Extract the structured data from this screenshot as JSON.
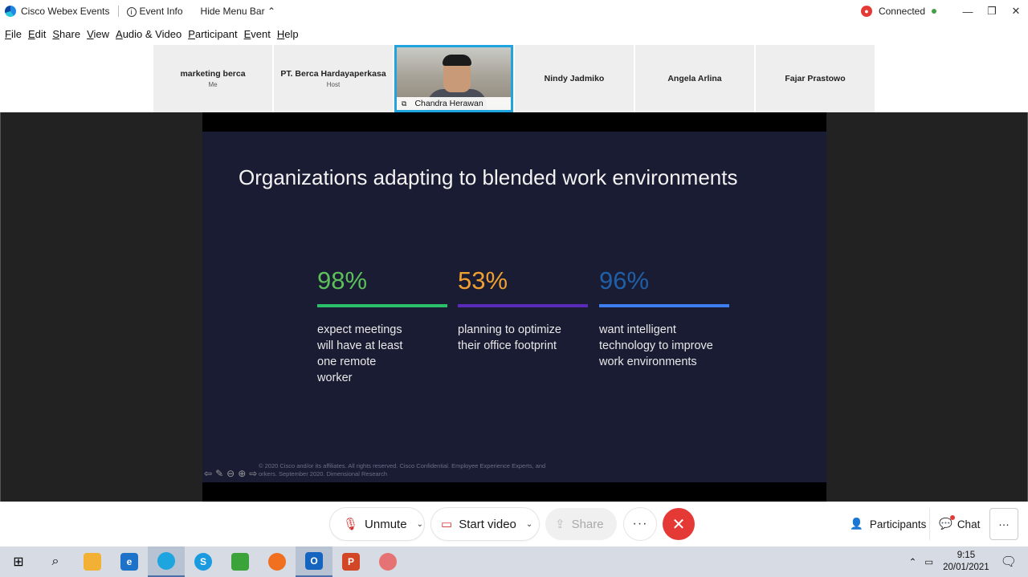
{
  "titlebar": {
    "app_name": "Cisco Webex Events",
    "event_info": "Event Info",
    "hide_menu": "Hide Menu Bar",
    "status": "Connected"
  },
  "menu": [
    "File",
    "Edit",
    "Share",
    "View",
    "Audio & Video",
    "Participant",
    "Event",
    "Help"
  ],
  "participants": [
    {
      "name": "marketing berca",
      "role": "Me"
    },
    {
      "name": "PT. Berca Hardayaperkasa",
      "role": "Host"
    },
    {
      "name": "Chandra Herawan",
      "role": ""
    },
    {
      "name": "Nindy Jadmiko",
      "role": ""
    },
    {
      "name": "Angela Arlina",
      "role": ""
    },
    {
      "name": "Fajar Prastowo",
      "role": ""
    }
  ],
  "slide": {
    "title": "Organizations adapting to blended work environments",
    "stats": [
      {
        "value": "98%",
        "text": "expect meetings will have at least one remote worker",
        "color": "#5cc05a",
        "bar": "#2bbf6a"
      },
      {
        "value": "53%",
        "text": "planning to optimize their office footprint",
        "color": "#f0a030",
        "bar": "#5a2ab8"
      },
      {
        "value": "96%",
        "text": "want intelligent technology to improve work environments",
        "color": "#1f5fa8",
        "bar": "#3d7ff0"
      }
    ],
    "footnote_1": "© 2020 Cisco and/or its affiliates. All rights reserved. Cisco Confidential. Employee Experience Experts, and",
    "footnote_2": "orkers. September 2020. Dimensional Research"
  },
  "controls": {
    "unmute": "Unmute",
    "start_video": "Start video",
    "share": "Share",
    "more": "···",
    "participants": "Participants",
    "chat": "Chat"
  },
  "taskbar": {
    "time": "9:15",
    "date": "20/01/2021"
  },
  "colors": {
    "accent": "#1ea5e0",
    "end_call": "#e53935",
    "slide_bg": "#1a1c33"
  }
}
